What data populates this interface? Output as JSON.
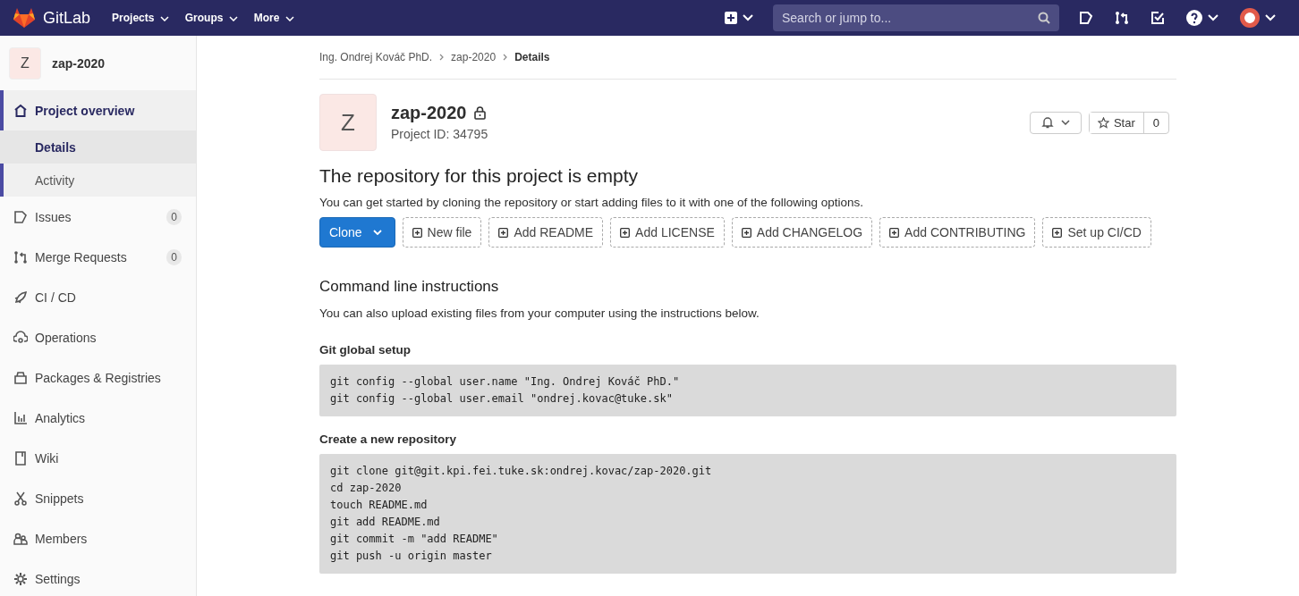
{
  "navbar": {
    "brand": "GitLab",
    "menus": [
      "Projects",
      "Groups",
      "More"
    ],
    "search": {
      "placeholder": "Search or jump to..."
    }
  },
  "sidebar": {
    "project": {
      "avatar": "Z",
      "name": "zap-2020"
    },
    "items": [
      {
        "label": "Project overview",
        "selected": true,
        "expanded": true,
        "children": [
          {
            "label": "Details",
            "selected": true
          },
          {
            "label": "Activity",
            "selected": false
          }
        ]
      },
      {
        "label": "Issues",
        "selected": false,
        "count": "0"
      },
      {
        "label": "Merge Requests",
        "selected": false,
        "count": "0"
      },
      {
        "label": "CI / CD",
        "selected": false
      },
      {
        "label": "Operations",
        "selected": false
      },
      {
        "label": "Packages & Registries",
        "selected": false
      },
      {
        "label": "Analytics",
        "selected": false
      },
      {
        "label": "Wiki",
        "selected": false
      },
      {
        "label": "Snippets",
        "selected": false
      },
      {
        "label": "Members",
        "selected": false
      },
      {
        "label": "Settings",
        "selected": false
      }
    ]
  },
  "breadcrumbs": [
    "Ing. Ondrej Kováč PhD.",
    "zap-2020",
    "Details"
  ],
  "project": {
    "avatar": "Z",
    "name": "zap-2020",
    "id": "Project ID: 34795",
    "star_label": "Star",
    "star_count": "0"
  },
  "empty": {
    "title": "The repository for this project is empty",
    "text": "You can get started by cloning the repository or start adding files to it with one of the following options.",
    "clone": "Clone",
    "actions": [
      "New file",
      "Add README",
      "Add LICENSE",
      "Add CHANGELOG",
      "Add CONTRIBUTING",
      "Set up CI/CD"
    ]
  },
  "instructions": {
    "title": "Command line instructions",
    "text": "You can also upload existing files from your computer using the instructions below.",
    "sections": [
      {
        "title": "Git global setup",
        "lines": [
          "git config --global user.name \"Ing. Ondrej Kováč PhD.\"",
          "git config --global user.email \"ondrej.kovac@tuke.sk\""
        ]
      },
      {
        "title": "Create a new repository",
        "lines": [
          "git clone git@git.kpi.fei.tuke.sk:ondrej.kovac/zap-2020.git",
          "cd zap-2020",
          "touch README.md",
          "git add README.md",
          "git commit -m \"add README\"",
          "git push -u origin master"
        ]
      }
    ]
  }
}
